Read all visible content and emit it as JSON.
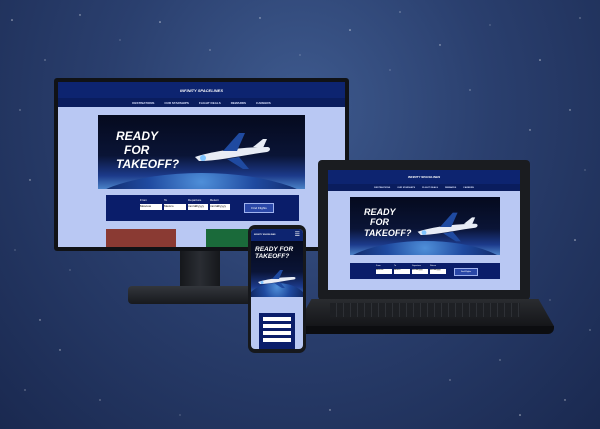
{
  "site": {
    "logo_text": "INFINITY SPACELINES",
    "nav": [
      "DESTINATIONS",
      "OUR STARSHIPS",
      "FLIGHT DEALS",
      "REWARDS",
      "CAREERS"
    ],
    "hero_line1": "READY",
    "hero_line2": "FOR",
    "hero_line3": "TAKEOFF?",
    "search": {
      "from_label": "From",
      "to_label": "To",
      "departure_label": "Departure",
      "return_label": "Return",
      "from_value": "Moscow",
      "to_value": "Mexico",
      "departure_value": "mm/dd/yyyy",
      "return_value": "mm/dd/yyyy",
      "button": "Find Flights"
    }
  },
  "colors": {
    "background": "#2a3f6e",
    "nav_blue": "#0d2470",
    "page_bg": "#b9c8f3",
    "search_bg": "#0a1d6a"
  }
}
